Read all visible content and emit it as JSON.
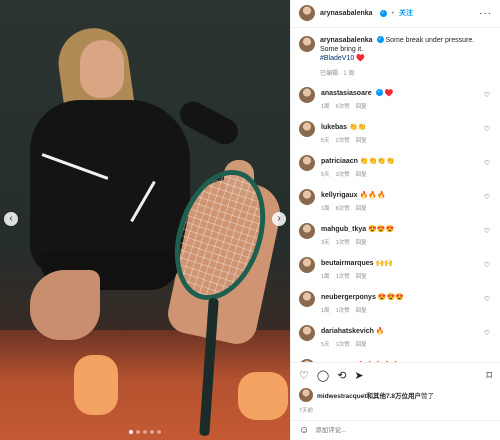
{
  "post": {
    "username": "arynasabalenka",
    "follow_separator": "•",
    "follow_label": "关注",
    "more_icon": "more-horizontal-icon",
    "caption_user": "arynasabalenka",
    "caption_text": "Some break under pressure. Some bring it.",
    "caption_hashtag": "#BladeV10",
    "caption_emoji": "♥️",
    "caption_meta": "已编辑 · 1 周"
  },
  "media": {
    "dots_count": 5,
    "active_dot": 0
  },
  "comments": [
    {
      "user": "anastasiasoare",
      "verified": true,
      "text": "♥️",
      "time": "1周",
      "likes": "6次赞",
      "reply": "回复"
    },
    {
      "user": "lukebas",
      "verified": false,
      "text": "👏👏",
      "time": "5天",
      "likes": "2次赞",
      "reply": "回复"
    },
    {
      "user": "patriciaacn",
      "verified": false,
      "text": "👏👏👏👏",
      "time": "5天",
      "likes": "3次赞",
      "reply": "回复"
    },
    {
      "user": "kellyrigaux",
      "verified": false,
      "text": "🔥🔥🔥",
      "time": "1周",
      "likes": "8次赞",
      "reply": "回复"
    },
    {
      "user": "mahgub_tkya",
      "verified": false,
      "text": "😍😍😍",
      "time": "3天",
      "likes": "1次赞",
      "reply": "回复"
    },
    {
      "user": "beutairmarques",
      "verified": false,
      "text": "🙌🙌",
      "time": "1周",
      "likes": "1次赞",
      "reply": "回复"
    },
    {
      "user": "neubergerponys",
      "verified": false,
      "text": "😍😍😍",
      "time": "1周",
      "likes": "1次赞",
      "reply": "回复"
    },
    {
      "user": "dariahatskevich",
      "verified": false,
      "text": "🔥",
      "time": "5天",
      "likes": "1次赞",
      "reply": "回复"
    },
    {
      "user": "poloagent",
      "verified": false,
      "text": "🔥🔥🔥🔥🔥",
      "time": "",
      "likes": "",
      "reply": ""
    }
  ],
  "actions": {
    "liked_by_user": "midwestracquet",
    "liked_by_rest": "和其他7.8万位用户",
    "liked_by_suffix": "赞了",
    "date": "7天前",
    "comment_placeholder": "添加评论..."
  }
}
